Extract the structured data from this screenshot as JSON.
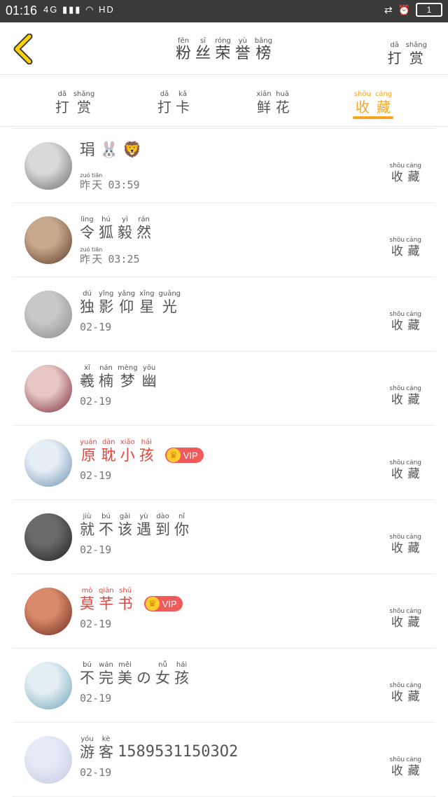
{
  "status_bar": {
    "time": "01:16",
    "signal": "4G",
    "battery": "1"
  },
  "header": {
    "title": [
      {
        "py": "fěn",
        "hz": "粉"
      },
      {
        "py": "sī",
        "hz": "丝"
      },
      {
        "py": "róng",
        "hz": "荣"
      },
      {
        "py": "yù",
        "hz": "誉"
      },
      {
        "py": "bǎng",
        "hz": "榜"
      }
    ],
    "action": [
      {
        "py": "dǎ",
        "hz": "打"
      },
      {
        "py": "shǎng",
        "hz": "赏"
      }
    ]
  },
  "tabs": [
    {
      "chars": [
        {
          "py": "dǎ",
          "hz": "打"
        },
        {
          "py": "shǎng",
          "hz": "赏"
        }
      ],
      "active": false
    },
    {
      "chars": [
        {
          "py": "dǎ",
          "hz": "打"
        },
        {
          "py": "kǎ",
          "hz": "卡"
        }
      ],
      "active": false
    },
    {
      "chars": [
        {
          "py": "xiān",
          "hz": "鲜"
        },
        {
          "py": "huā",
          "hz": "花"
        }
      ],
      "active": true,
      "_unused": false
    },
    {
      "chars": [
        {
          "py": "shōu",
          "hz": "收"
        },
        {
          "py": "cáng",
          "hz": "藏"
        }
      ],
      "active": true
    }
  ],
  "row_action": [
    {
      "py": "shōu",
      "hz": "收"
    },
    {
      "py": "cáng",
      "hz": "藏"
    }
  ],
  "rows": [
    {
      "name_plain": "琄",
      "emojis": [
        "🐰",
        "🦁"
      ],
      "vip": false,
      "time_prefix": [
        {
          "py": "zuó",
          "hz": "昨"
        },
        {
          "py": "tiān",
          "hz": "天"
        }
      ],
      "time": "03:59",
      "avatar_colors": [
        "#d9d9d9",
        "#6a6a6a"
      ]
    },
    {
      "name": [
        {
          "py": "lìng",
          "hz": "令"
        },
        {
          "py": "hú",
          "hz": "狐"
        },
        {
          "py": "yì",
          "hz": "毅"
        },
        {
          "py": "rán",
          "hz": "然"
        }
      ],
      "vip": false,
      "time_prefix": [
        {
          "py": "zuó",
          "hz": "昨"
        },
        {
          "py": "tiān",
          "hz": "天"
        }
      ],
      "time": "03:25",
      "avatar_colors": [
        "#c9a98b",
        "#5a3b2a"
      ]
    },
    {
      "name": [
        {
          "py": "dú",
          "hz": "独"
        },
        {
          "py": "yǐng",
          "hz": "影"
        },
        {
          "py": "yǎng",
          "hz": "仰"
        },
        {
          "py": "xīng",
          "hz": "星"
        },
        {
          "py": "guāng",
          "hz": "光"
        }
      ],
      "vip": false,
      "time": "02-19",
      "avatar_colors": [
        "#c8c8c8",
        "#8a8a8a"
      ]
    },
    {
      "name": [
        {
          "py": "xī",
          "hz": "羲"
        },
        {
          "py": "nán",
          "hz": "楠"
        },
        {
          "py": "mèng",
          "hz": "梦"
        },
        {
          "py": "yōu",
          "hz": "幽"
        }
      ],
      "vip": false,
      "time": "02-19",
      "avatar_colors": [
        "#e8c6c6",
        "#7a2a3a"
      ]
    },
    {
      "name": [
        {
          "py": "yuán",
          "hz": "原"
        },
        {
          "py": "dān",
          "hz": "耽"
        },
        {
          "py": "xiǎo",
          "hz": "小"
        },
        {
          "py": "hái",
          "hz": "孩"
        }
      ],
      "vip": true,
      "vip_label": "VIP",
      "time": "02-19",
      "avatar_colors": [
        "#e6eef6",
        "#6c8fb0"
      ]
    },
    {
      "name": [
        {
          "py": "jiù",
          "hz": "就"
        },
        {
          "py": "bú",
          "hz": "不"
        },
        {
          "py": "gāi",
          "hz": "该"
        },
        {
          "py": "yù",
          "hz": "遇"
        },
        {
          "py": "dào",
          "hz": "到"
        },
        {
          "py": "nǐ",
          "hz": "你"
        }
      ],
      "vip": false,
      "time": "02-19",
      "avatar_colors": [
        "#6a6a6a",
        "#1f1f1f"
      ]
    },
    {
      "name": [
        {
          "py": "mò",
          "hz": "莫"
        },
        {
          "py": "qiān",
          "hz": "芊"
        },
        {
          "py": "shū",
          "hz": "书"
        }
      ],
      "vip": true,
      "vip_label": "VIP",
      "time": "02-19",
      "avatar_colors": [
        "#d98a6a",
        "#6b2a20"
      ]
    },
    {
      "name": [
        {
          "py": "bú",
          "hz": "不"
        },
        {
          "py": "wán",
          "hz": "完"
        },
        {
          "py": "měi",
          "hz": "美"
        },
        {
          "py": "",
          "hz": "の"
        },
        {
          "py": "nǚ",
          "hz": "女"
        },
        {
          "py": "hái",
          "hz": "孩"
        }
      ],
      "vip": false,
      "time": "02-19",
      "avatar_colors": [
        "#e2eef2",
        "#6fa3b8"
      ]
    },
    {
      "name": [
        {
          "py": "yóu",
          "hz": "游"
        },
        {
          "py": "kè",
          "hz": "客"
        }
      ],
      "name_suffix": "15895311503O2",
      "vip": false,
      "time": "02-19",
      "avatar_colors": [
        "#e6eaf6",
        "#c3c9e0"
      ]
    }
  ]
}
